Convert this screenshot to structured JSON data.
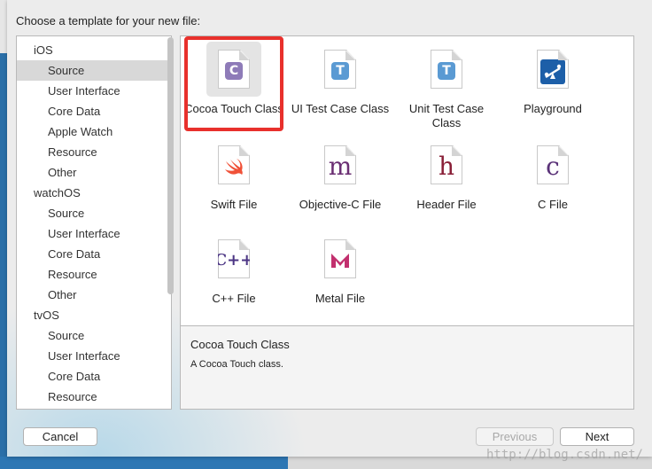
{
  "dialog": {
    "heading": "Choose a template for your new file:"
  },
  "sidebar": {
    "sections": [
      {
        "label": "iOS",
        "items": [
          "Source",
          "User Interface",
          "Core Data",
          "Apple Watch",
          "Resource",
          "Other"
        ]
      },
      {
        "label": "watchOS",
        "items": [
          "Source",
          "User Interface",
          "Core Data",
          "Resource",
          "Other"
        ]
      },
      {
        "label": "tvOS",
        "items": [
          "Source",
          "User Interface",
          "Core Data",
          "Resource"
        ]
      }
    ],
    "selected": "iOS / Source"
  },
  "templates": [
    {
      "label": "Cocoa Touch Class",
      "icon": "cocoa-touch-class-icon",
      "glyph": "C",
      "color": "#8e7bb8",
      "selected": true
    },
    {
      "label": "UI Test Case Class",
      "icon": "ui-test-case-class-icon",
      "glyph": "T",
      "color": "#5a9ad3"
    },
    {
      "label": "Unit Test Case Class",
      "icon": "unit-test-case-class-icon",
      "glyph": "T",
      "color": "#5a9ad3"
    },
    {
      "label": "Playground",
      "icon": "playground-icon",
      "color": "#1d5fa8"
    },
    {
      "label": "Swift File",
      "icon": "swift-file-icon",
      "color": "#f05138"
    },
    {
      "label": "Objective-C File",
      "icon": "objective-c-file-icon",
      "glyph": "m",
      "color": "#6b2f73"
    },
    {
      "label": "Header File",
      "icon": "header-file-icon",
      "glyph": "h",
      "color": "#8a2038"
    },
    {
      "label": "C File",
      "icon": "c-file-icon",
      "glyph": "c",
      "color": "#5a3278"
    },
    {
      "label": "C++ File",
      "icon": "cpp-file-icon",
      "glyph": "C++",
      "color": "#4b3584"
    },
    {
      "label": "Metal File",
      "icon": "metal-file-icon",
      "color": "#c2306e"
    }
  ],
  "description": {
    "title": "Cocoa Touch Class",
    "text": "A Cocoa Touch class."
  },
  "buttons": {
    "cancel": "Cancel",
    "previous": "Previous",
    "next": "Next"
  },
  "watermark": "http://blog.csdn.net/",
  "colors": {
    "highlight": "#e8302c",
    "selection": "#d8d8d8"
  }
}
